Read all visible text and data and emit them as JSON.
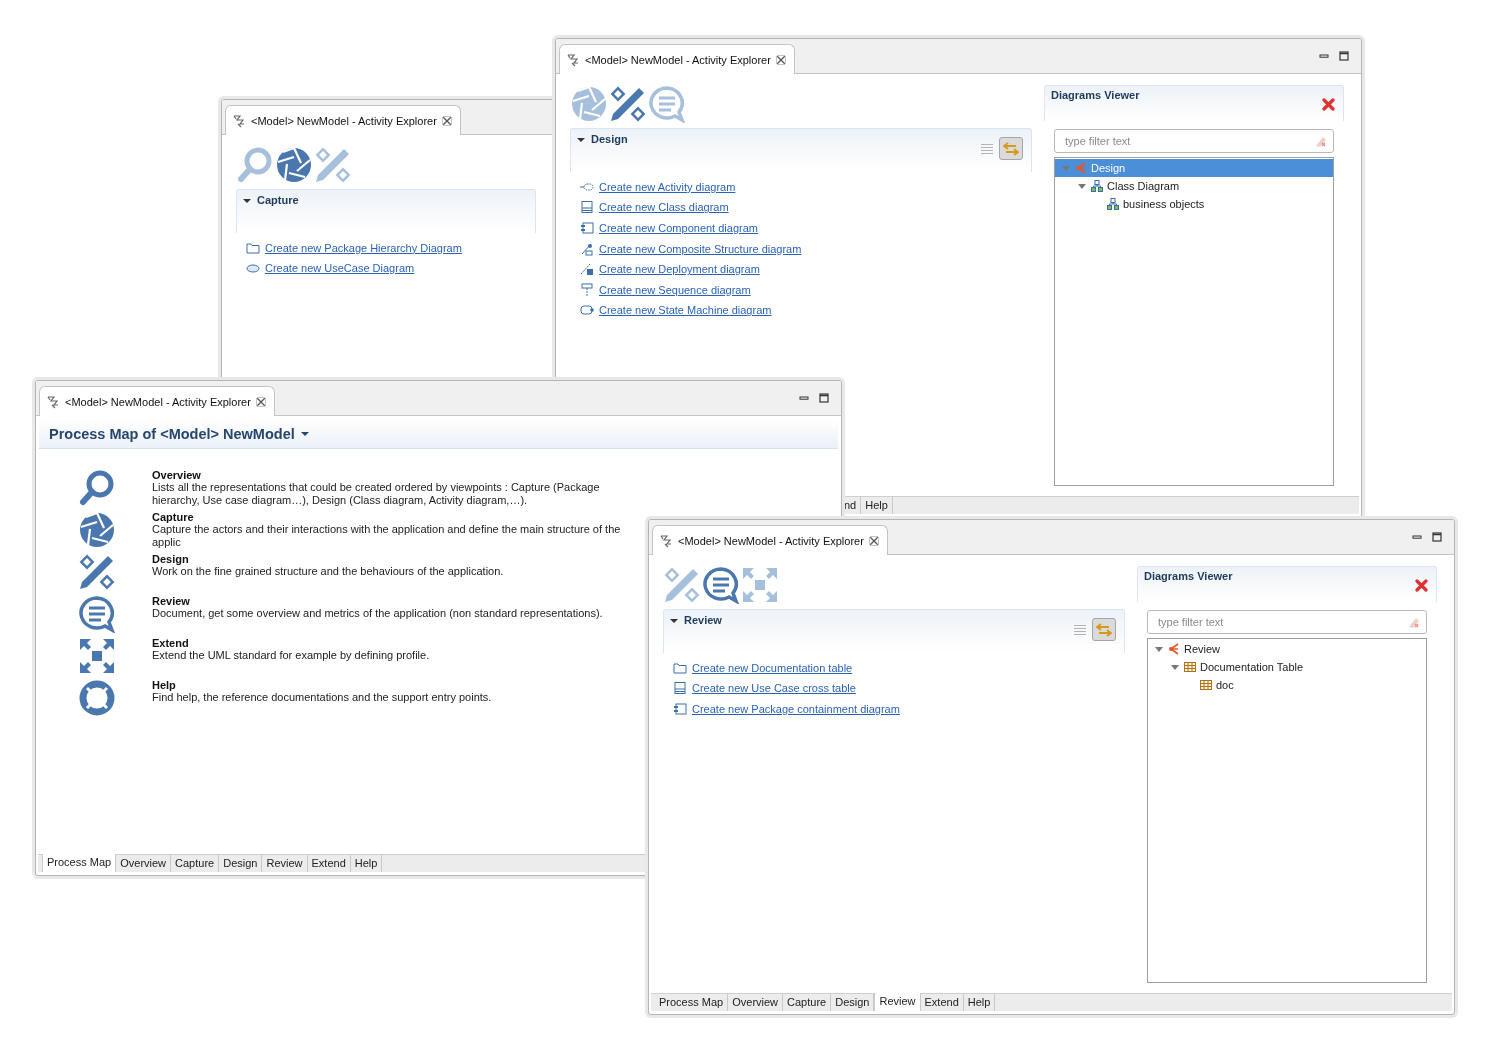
{
  "windows": [
    {
      "kind": "explorer",
      "tab_title": "<Model> NewModel - Activity Explorer",
      "window_controls": false,
      "viewpoints": [
        {
          "kind": "overview",
          "selected": false
        },
        {
          "kind": "capture",
          "selected": true
        },
        {
          "kind": "design",
          "selected": false
        }
      ],
      "section": {
        "title": "Capture",
        "expanded": true,
        "toolbar": false,
        "links": [
          {
            "kind": "folder",
            "label": "Create new Package Hierarchy Diagram"
          },
          {
            "kind": "usecase",
            "label": "Create new UseCase Diagram"
          }
        ]
      }
    },
    {
      "kind": "explorer",
      "tab_title": "<Model> NewModel - Activity Explorer",
      "window_controls": true,
      "viewpoints": [
        {
          "kind": "capture",
          "selected": false
        },
        {
          "kind": "design",
          "selected": true
        },
        {
          "kind": "review",
          "selected": false
        }
      ],
      "section": {
        "title": "Design",
        "expanded": true,
        "toolbar": true,
        "links": [
          {
            "kind": "activity",
            "label": "Create new Activity diagram"
          },
          {
            "kind": "class",
            "label": "Create new Class diagram"
          },
          {
            "kind": "component",
            "label": "Create new Component diagram"
          },
          {
            "kind": "composite",
            "label": "Create new Composite Structure diagram"
          },
          {
            "kind": "deployment",
            "label": "Create new Deployment diagram"
          },
          {
            "kind": "sequence",
            "label": "Create new Sequence diagram"
          },
          {
            "kind": "statemachine",
            "label": "Create new State Machine diagram"
          }
        ]
      },
      "diagrams_viewer": {
        "title": "Diagrams Viewer",
        "filter_placeholder": "type filter text",
        "tree": [
          {
            "kind": "viewpoint",
            "label": "Design",
            "selected": true,
            "expanded": true,
            "children": [
              {
                "kind": "diagram",
                "label": "Class Diagram",
                "selected": false,
                "expanded": true,
                "children": [
                  {
                    "kind": "diagram",
                    "label": "business objects",
                    "selected": false
                  }
                ]
              }
            ]
          }
        ]
      },
      "bottom_tabs": [
        {
          "label": "nd",
          "selected": false
        },
        {
          "label": "Help",
          "selected": false
        }
      ]
    },
    {
      "kind": "process_map",
      "tab_title": "<Model> NewModel - Activity Explorer",
      "window_controls": true,
      "heading": "Process Map of <Model> NewModel",
      "entries": [
        {
          "kind": "overview",
          "title": "Overview",
          "description": "Lists all the representations that could be created ordered by viewpoints : Capture (Package hierarchy, Use case diagram…), Design (Class diagram, Activity diagram,…)."
        },
        {
          "kind": "capture",
          "title": "Capture",
          "description": "Capture the actors and their interactions with the application and define the main structure of the applic"
        },
        {
          "kind": "design",
          "title": "Design",
          "description": "Work on the fine grained structure and the behaviours of the application."
        },
        {
          "kind": "review",
          "title": "Review",
          "description": "Document, get some overview and metrics of the application (non standard representations)."
        },
        {
          "kind": "extend",
          "title": "Extend",
          "description": "Extend the UML standard for example by defining profile."
        },
        {
          "kind": "help",
          "title": "Help",
          "description": "Find help, the reference documentations and the support entry points."
        }
      ],
      "bottom_tabs": [
        {
          "label": "Process Map",
          "selected": true
        },
        {
          "label": "Overview",
          "selected": false
        },
        {
          "label": "Capture",
          "selected": false
        },
        {
          "label": "Design",
          "selected": false
        },
        {
          "label": "Review",
          "selected": false
        },
        {
          "label": "Extend",
          "selected": false
        },
        {
          "label": "Help",
          "selected": false
        }
      ]
    },
    {
      "kind": "explorer",
      "tab_title": "<Model> NewModel - Activity Explorer",
      "window_controls": true,
      "viewpoints": [
        {
          "kind": "design",
          "selected": false
        },
        {
          "kind": "review",
          "selected": true
        },
        {
          "kind": "extend",
          "selected": false
        }
      ],
      "section": {
        "title": "Review",
        "expanded": true,
        "toolbar": true,
        "links": [
          {
            "kind": "folder",
            "label": "Create new Documentation table"
          },
          {
            "kind": "class",
            "label": "Create new Use Case cross table"
          },
          {
            "kind": "component",
            "label": "Create new Package containment diagram"
          }
        ]
      },
      "diagrams_viewer": {
        "title": "Diagrams Viewer",
        "filter_placeholder": "type filter text",
        "tree": [
          {
            "kind": "viewpoint",
            "label": "Review",
            "selected": false,
            "expanded": true,
            "children": [
              {
                "kind": "table",
                "label": "Documentation Table",
                "selected": false,
                "expanded": true,
                "children": [
                  {
                    "kind": "table",
                    "label": "doc",
                    "selected": false
                  }
                ]
              }
            ]
          }
        ]
      },
      "bottom_tabs": [
        {
          "label": "Process Map",
          "selected": false
        },
        {
          "label": "Overview",
          "selected": false
        },
        {
          "label": "Capture",
          "selected": false
        },
        {
          "label": "Design",
          "selected": false
        },
        {
          "label": "Review",
          "selected": true
        },
        {
          "label": "Extend",
          "selected": false
        },
        {
          "label": "Help",
          "selected": false
        }
      ]
    }
  ]
}
